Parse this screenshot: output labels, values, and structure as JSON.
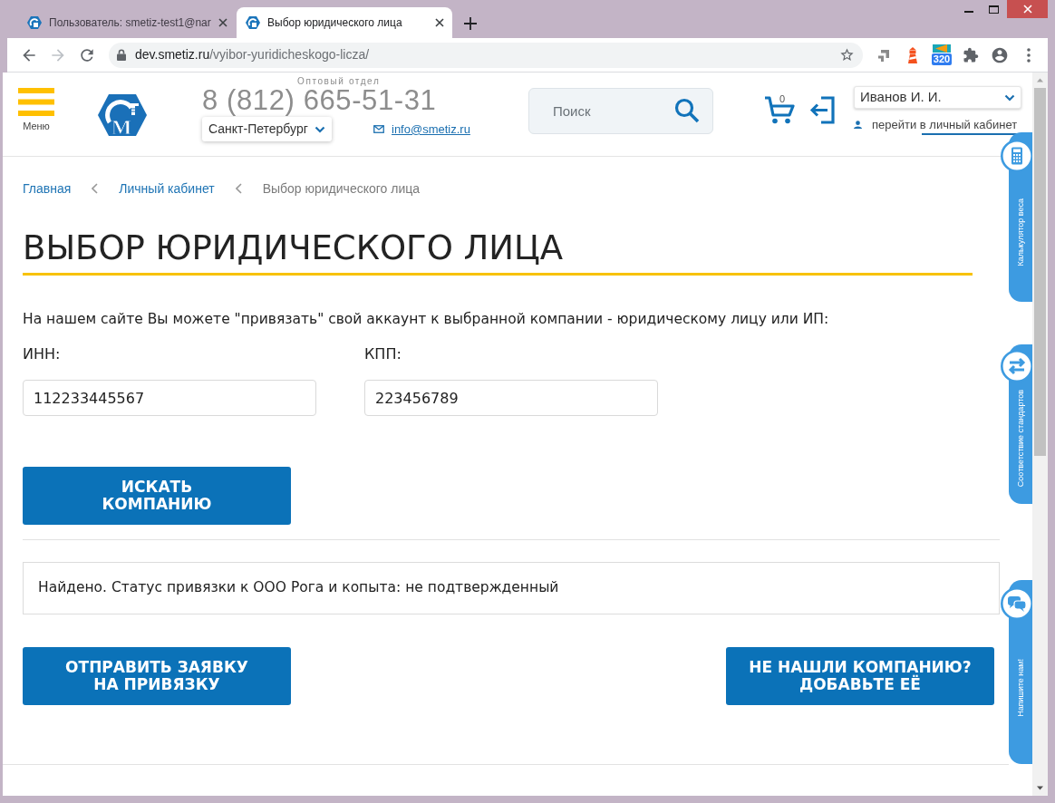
{
  "browser": {
    "tabs": [
      {
        "title": "Пользователь: smetiz-test1@nar",
        "selected": false
      },
      {
        "title": "Выбор юридического лица",
        "selected": true
      }
    ],
    "navigation": [
      {
        "kind": "back",
        "disabled": false
      },
      {
        "kind": "forward",
        "disabled": true
      },
      {
        "kind": "reload",
        "disabled": false
      }
    ],
    "address": {
      "host": "dev.smetiz.ru",
      "path": "/vyibor-yuridicheskogo-licza/"
    },
    "extension_counter": "320"
  },
  "header": {
    "menu_label": "Меню",
    "logo_letter": "М",
    "phone_caption": "Оптовый отдел",
    "phone": "8 (812) 665-51-31",
    "city": "Санкт-Петербург",
    "email": "info@smetiz.ru",
    "search": {
      "placeholder": "Поиск"
    },
    "cart_count": "0",
    "user": "Иванов И. И.",
    "cabinet_link": "перейти в личный кабинет"
  },
  "breadcrumbs": [
    {
      "label": "Главная",
      "current": false
    },
    {
      "label": "Личный кабинет",
      "current": false
    },
    {
      "label": "Выбор юридического лица",
      "current": true
    }
  ],
  "title": "ВЫБОР ЮРИДИЧЕСКОГО ЛИЦА",
  "intro": "На нашем сайте Вы можете \"привязать\" свой аккаунт к выбранной компании - юридическому лицу или ИП:",
  "fields": [
    {
      "label": "ИНН:",
      "value": "112233445567"
    },
    {
      "label": "КПП:",
      "value": "223456789"
    }
  ],
  "search_button": {
    "lines": [
      "ИСКАТЬ",
      "КОМПАНИЮ"
    ]
  },
  "status": "Найдено. Статус привязки к ООО Рога и копыта: не подтвержденный",
  "actions": [
    {
      "lines": [
        "ОТПРАВИТЬ ЗАЯВКУ",
        "НА ПРИВЯЗКУ"
      ]
    },
    {
      "lines": [
        "НЕ НАШЛИ КОМПАНИЮ?",
        "ДОБАВЬТЕ ЕЁ"
      ]
    }
  ],
  "side_tabs": [
    {
      "kind": "calculator",
      "label": "Калькулятор веса"
    },
    {
      "kind": "exchange",
      "label": "Соответствие стандартов"
    },
    {
      "kind": "chat",
      "label": "Напишите нам!"
    }
  ]
}
